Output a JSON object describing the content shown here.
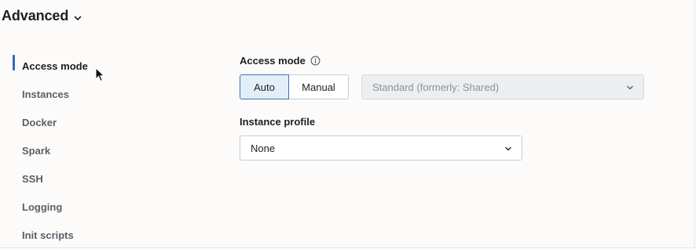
{
  "section": {
    "title": "Advanced",
    "chevron_icon": "chevron-down-icon"
  },
  "nav": {
    "active_index": 0,
    "items": [
      {
        "label": "Access mode"
      },
      {
        "label": "Instances"
      },
      {
        "label": "Docker"
      },
      {
        "label": "Spark"
      },
      {
        "label": "SSH"
      },
      {
        "label": "Logging"
      },
      {
        "label": "Init scripts"
      }
    ]
  },
  "access_mode": {
    "label": "Access mode",
    "info_icon": "info-icon",
    "toggle": {
      "auto_label": "Auto",
      "manual_label": "Manual",
      "selected": "Auto"
    },
    "select": {
      "value": "Standard (formerly: Shared)",
      "disabled": true
    }
  },
  "instance_profile": {
    "label": "Instance profile",
    "select": {
      "value": "None"
    }
  },
  "colors": {
    "accent": "#2f6db5",
    "toggle_selected_bg": "#e3eef9",
    "disabled_bg": "#eceeef"
  }
}
